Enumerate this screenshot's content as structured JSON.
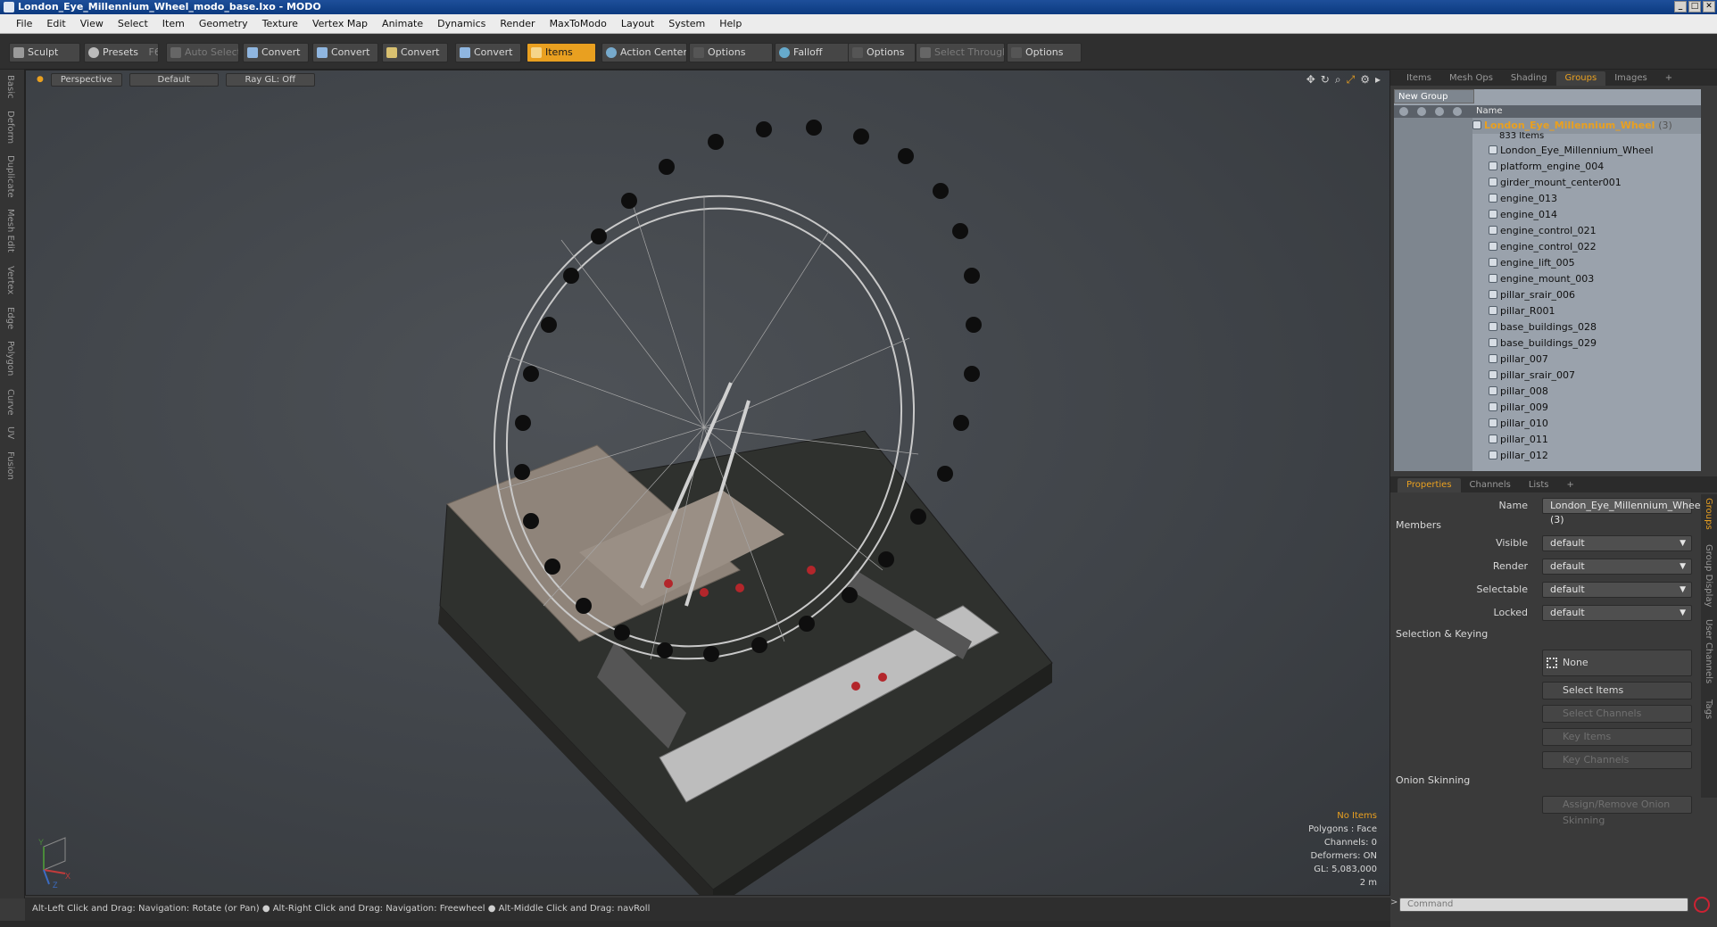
{
  "window": {
    "title": "London_Eye_Millennium_Wheel_modo_base.lxo - MODO"
  },
  "menu": [
    "File",
    "Edit",
    "View",
    "Select",
    "Item",
    "Geometry",
    "Texture",
    "Vertex Map",
    "Animate",
    "Dynamics",
    "Render",
    "MaxToModo",
    "Layout",
    "System",
    "Help"
  ],
  "toolbar": {
    "sculpt": "Sculpt",
    "presets": "Presets",
    "presets_key": "F6",
    "auto_select": "Auto Select",
    "convert": "Convert",
    "items": "Items",
    "action_center": "Action Center",
    "options": "Options",
    "falloff": "Falloff",
    "select_through": "Select Through"
  },
  "left_tabs": [
    "Basic",
    "Deform",
    "Duplicate",
    "Mesh Edit",
    "Vertex",
    "Edge",
    "Polygon",
    "Curve",
    "UV",
    "Fusion"
  ],
  "viewport": {
    "view": "Perspective",
    "shading": "Default",
    "raygl": "Ray GL: Off",
    "stats": {
      "items": "No Items",
      "polygons": "Polygons : Face",
      "channels": "Channels: 0",
      "deformers": "Deformers: ON",
      "gl": "GL: 5,083,000",
      "scale": "2 m"
    },
    "axis": {
      "x": "X",
      "y": "Y",
      "z": "Z"
    }
  },
  "status": "Alt-Left Click and Drag: Navigation: Rotate (or Pan) ● Alt-Right Click and Drag: Navigation: Freewheel ● Alt-Middle Click and Drag: navRoll",
  "top_tabs": [
    "Items",
    "Mesh Ops",
    "Shading",
    "Groups",
    "Images",
    "+"
  ],
  "groups": {
    "new_group": "New Group",
    "name_header": "Name",
    "group_name": "London_Eye_Millennium_Wheel",
    "group_suffix": "(3)",
    "count": "833 Items",
    "items": [
      "London_Eye_Millennium_Wheel",
      "platform_engine_004",
      "girder_mount_center001",
      "engine_013",
      "engine_014",
      "engine_control_021",
      "engine_control_022",
      "engine_lift_005",
      "engine_mount_003",
      "pillar_srair_006",
      "pillar_R001",
      "base_buildings_028",
      "base_buildings_029",
      "pillar_007",
      "pillar_srair_007",
      "pillar_008",
      "pillar_009",
      "pillar_010",
      "pillar_011",
      "pillar_012"
    ]
  },
  "prop_tabs": [
    "Properties",
    "Channels",
    "Lists",
    "+"
  ],
  "properties": {
    "name_label": "Name",
    "name_value": "London_Eye_Millennium_Wheel (3)",
    "members": "Members",
    "visible_label": "Visible",
    "render_label": "Render",
    "selectable_label": "Selectable",
    "locked_label": "Locked",
    "default": "default",
    "selection_keying": "Selection & Keying",
    "none": "None",
    "select_items": "Select Items",
    "select_channels": "Select Channels",
    "key_items": "Key Items",
    "key_channels": "Key Channels",
    "onion": "Onion Skinning",
    "assign_onion": "Assign/Remove Onion Skinning"
  },
  "side_tabs": [
    "Groups",
    "Group Display",
    "User Channels",
    "Tags"
  ],
  "command": {
    "placeholder": "Command",
    "prompt": ">"
  }
}
